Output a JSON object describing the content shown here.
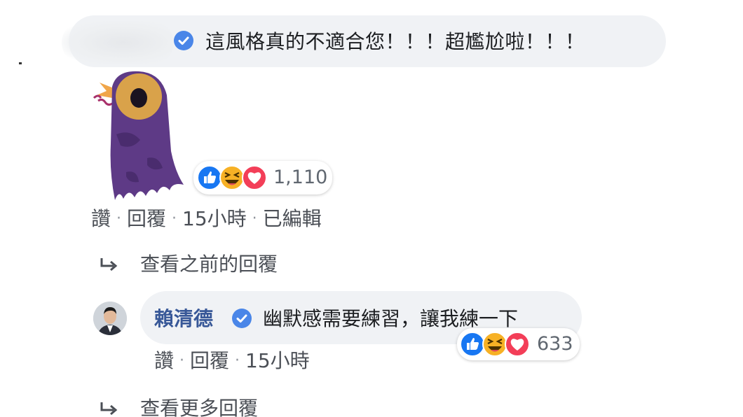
{
  "comment": {
    "author_verified_icon": "verified-check-icon",
    "text": "這風格真的不適合您！！！超尷尬啦！！！",
    "sticker": "purple-bird-sticker",
    "reactions": {
      "icons": [
        "like-icon",
        "haha-icon",
        "love-icon"
      ],
      "count": "1,110"
    },
    "actions": {
      "like": "讚",
      "reply": "回覆",
      "time": "15小時",
      "edited": "已編輯"
    }
  },
  "view_previous_replies": "查看之前的回覆",
  "reply": {
    "author": "賴清德",
    "text": "幽默感需要練習，讓我練一下",
    "reactions": {
      "icons": [
        "like-icon",
        "haha-icon",
        "love-icon"
      ],
      "count": "633"
    },
    "actions": {
      "like": "讚",
      "reply": "回覆",
      "time": "15小時"
    }
  },
  "view_more_replies": "查看更多回覆",
  "colors": {
    "bubble": "#f0f2f5",
    "link": "#385898",
    "verified": "#4a86e8",
    "like": "#1877f2",
    "love": "#f33e58",
    "haha": "#f7b125"
  }
}
